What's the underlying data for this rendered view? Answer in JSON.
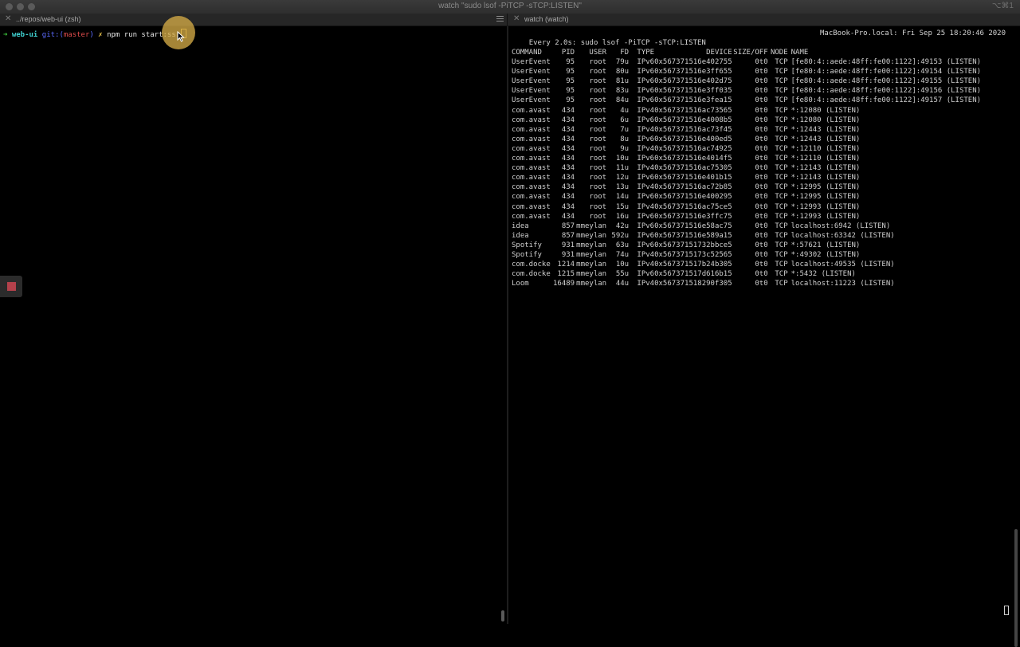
{
  "window": {
    "title": "watch \"sudo lsof -PiTCP -sTCP:LISTEN\"",
    "keyhint": "⌥⌘1"
  },
  "tabs": [
    {
      "label": "../repos/web-ui (zsh)",
      "close": "✕"
    },
    {
      "label": "watch (watch)",
      "close": "✕"
    }
  ],
  "shell": {
    "arrow": "➜",
    "dir": "web-ui",
    "git_open": "git:(",
    "branch": "master",
    "git_close": ")",
    "dirty": "✗",
    "command": "npm run start:ssr"
  },
  "watch": {
    "header": "Every 2.0s: sudo lsof -PiTCP -sTCP:LISTEN",
    "host": "MacBook-Pro.local: Fri Sep 25 18:20:46 2020"
  },
  "lsof": {
    "columns": [
      "COMMAND",
      "PID",
      "USER",
      "FD",
      "TYPE",
      "DEVICE",
      "SIZE/OFF",
      "NODE",
      "NAME"
    ],
    "rows": [
      [
        "UserEvent",
        "95",
        "root",
        "79u",
        "IPv6",
        "0x567371516e402755",
        "0t0",
        "TCP",
        "[fe80:4::aede:48ff:fe00:1122]:49153 (LISTEN)"
      ],
      [
        "UserEvent",
        "95",
        "root",
        "80u",
        "IPv6",
        "0x567371516e3ff655",
        "0t0",
        "TCP",
        "[fe80:4::aede:48ff:fe00:1122]:49154 (LISTEN)"
      ],
      [
        "UserEvent",
        "95",
        "root",
        "81u",
        "IPv6",
        "0x567371516e402d75",
        "0t0",
        "TCP",
        "[fe80:4::aede:48ff:fe00:1122]:49155 (LISTEN)"
      ],
      [
        "UserEvent",
        "95",
        "root",
        "83u",
        "IPv6",
        "0x567371516e3ff035",
        "0t0",
        "TCP",
        "[fe80:4::aede:48ff:fe00:1122]:49156 (LISTEN)"
      ],
      [
        "UserEvent",
        "95",
        "root",
        "84u",
        "IPv6",
        "0x567371516e3fea15",
        "0t0",
        "TCP",
        "[fe80:4::aede:48ff:fe00:1122]:49157 (LISTEN)"
      ],
      [
        "com.avast",
        "434",
        "root",
        "4u",
        "IPv4",
        "0x567371516ac73565",
        "0t0",
        "TCP",
        "*:12080 (LISTEN)"
      ],
      [
        "com.avast",
        "434",
        "root",
        "6u",
        "IPv6",
        "0x567371516e4008b5",
        "0t0",
        "TCP",
        "*:12080 (LISTEN)"
      ],
      [
        "com.avast",
        "434",
        "root",
        "7u",
        "IPv4",
        "0x567371516ac73f45",
        "0t0",
        "TCP",
        "*:12443 (LISTEN)"
      ],
      [
        "com.avast",
        "434",
        "root",
        "8u",
        "IPv6",
        "0x567371516e400ed5",
        "0t0",
        "TCP",
        "*:12443 (LISTEN)"
      ],
      [
        "com.avast",
        "434",
        "root",
        "9u",
        "IPv4",
        "0x567371516ac74925",
        "0t0",
        "TCP",
        "*:12110 (LISTEN)"
      ],
      [
        "com.avast",
        "434",
        "root",
        "10u",
        "IPv6",
        "0x567371516e4014f5",
        "0t0",
        "TCP",
        "*:12110 (LISTEN)"
      ],
      [
        "com.avast",
        "434",
        "root",
        "11u",
        "IPv4",
        "0x567371516ac75305",
        "0t0",
        "TCP",
        "*:12143 (LISTEN)"
      ],
      [
        "com.avast",
        "434",
        "root",
        "12u",
        "IPv6",
        "0x567371516e401b15",
        "0t0",
        "TCP",
        "*:12143 (LISTEN)"
      ],
      [
        "com.avast",
        "434",
        "root",
        "13u",
        "IPv4",
        "0x567371516ac72b85",
        "0t0",
        "TCP",
        "*:12995 (LISTEN)"
      ],
      [
        "com.avast",
        "434",
        "root",
        "14u",
        "IPv6",
        "0x567371516e400295",
        "0t0",
        "TCP",
        "*:12995 (LISTEN)"
      ],
      [
        "com.avast",
        "434",
        "root",
        "15u",
        "IPv4",
        "0x567371516ac75ce5",
        "0t0",
        "TCP",
        "*:12993 (LISTEN)"
      ],
      [
        "com.avast",
        "434",
        "root",
        "16u",
        "IPv6",
        "0x567371516e3ffc75",
        "0t0",
        "TCP",
        "*:12993 (LISTEN)"
      ],
      [
        "idea",
        "857",
        "mmeylan",
        "42u",
        "IPv6",
        "0x567371516e58ac75",
        "0t0",
        "TCP",
        "localhost:6942 (LISTEN)"
      ],
      [
        "idea",
        "857",
        "mmeylan",
        "592u",
        "IPv6",
        "0x567371516e589a15",
        "0t0",
        "TCP",
        "localhost:63342 (LISTEN)"
      ],
      [
        "Spotify",
        "931",
        "mmeylan",
        "63u",
        "IPv6",
        "0x56737151732bbce5",
        "0t0",
        "TCP",
        "*:57621 (LISTEN)"
      ],
      [
        "Spotify",
        "931",
        "mmeylan",
        "74u",
        "IPv4",
        "0x5673715173c52565",
        "0t0",
        "TCP",
        "*:49302 (LISTEN)"
      ],
      [
        "com.docke",
        "1214",
        "mmeylan",
        "10u",
        "IPv4",
        "0x567371517b24b305",
        "0t0",
        "TCP",
        "localhost:49535 (LISTEN)"
      ],
      [
        "com.docke",
        "1215",
        "mmeylan",
        "55u",
        "IPv6",
        "0x567371517d616b15",
        "0t0",
        "TCP",
        "*:5432 (LISTEN)"
      ],
      [
        "Loom",
        "16489",
        "mmeylan",
        "44u",
        "IPv4",
        "0x567371518290f305",
        "0t0",
        "TCP",
        "localhost:11223 (LISTEN)"
      ]
    ]
  },
  "colors": {
    "background": "#000000",
    "halo": "#d4aa46",
    "prompt_arrow": "#3fd03f",
    "branch": "#e04c4c"
  }
}
